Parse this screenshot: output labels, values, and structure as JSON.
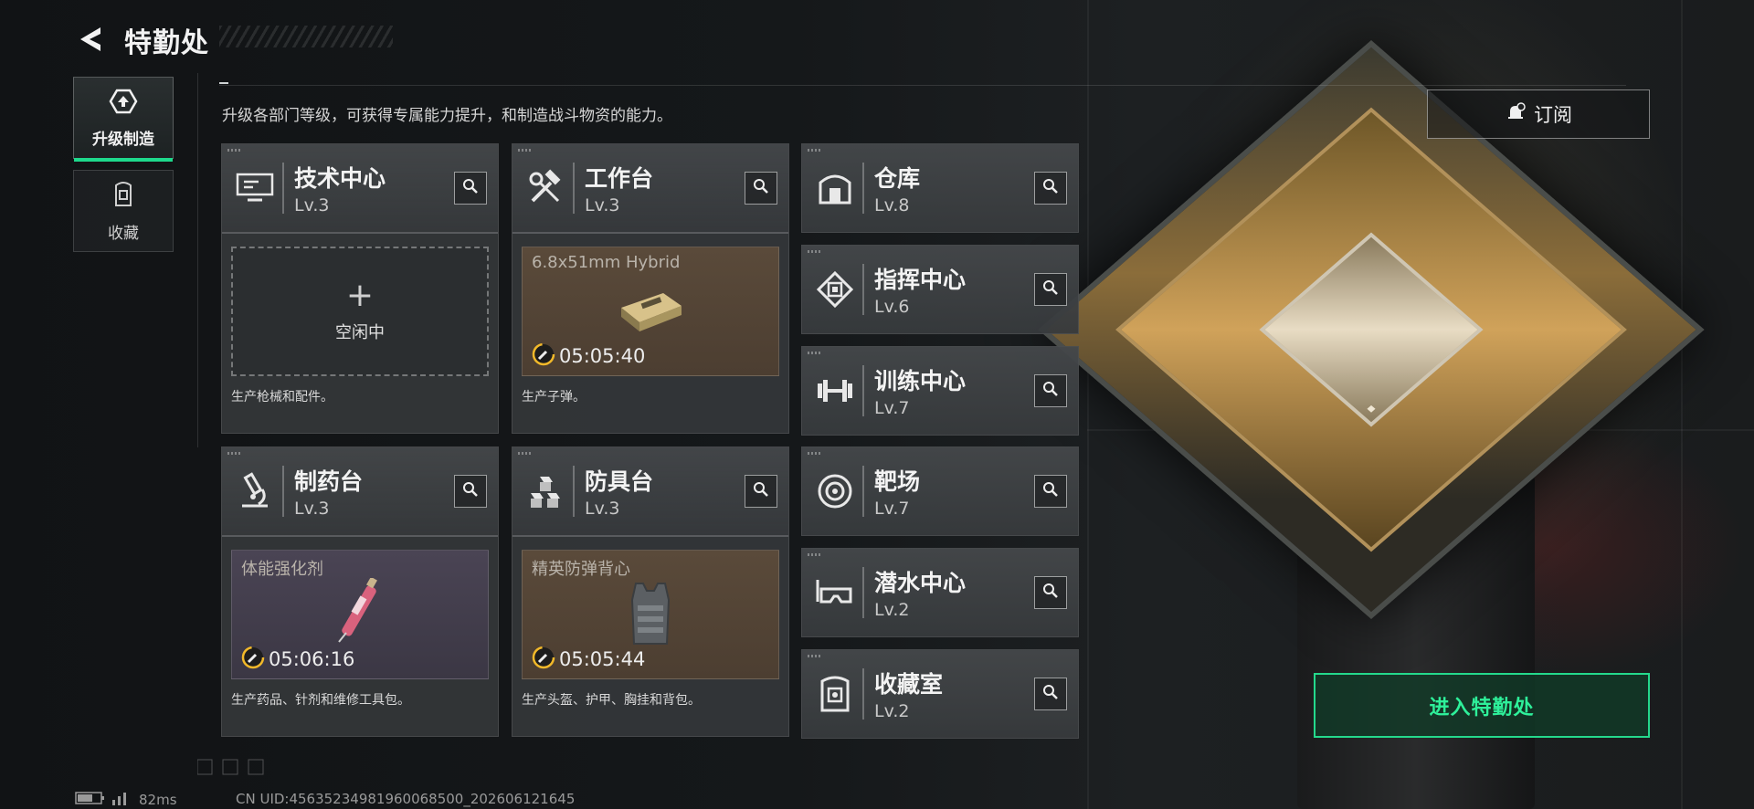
{
  "header": {
    "title": "特勤处"
  },
  "tabs": [
    {
      "label": "升级制造",
      "icon": "upgrade-icon",
      "active": true
    },
    {
      "label": "收藏",
      "icon": "collection-icon",
      "active": false
    }
  ],
  "subtitle": "升级各部门等级，可获得专属能力提升，和制造战斗物资的能力。",
  "stations_main": [
    {
      "name": "技术中心",
      "level": "Lv.3",
      "icon": "computer-icon",
      "slot": {
        "state": "idle",
        "plus": "+",
        "idle_label": "空闲中"
      },
      "description": "生产枪械和配件。"
    },
    {
      "name": "工作台",
      "level": "Lv.3",
      "icon": "tools-icon",
      "slot": {
        "state": "producing",
        "item": "6.8x51mm Hybrid",
        "timer": "05:05:40",
        "item_icon": "ammo-box-icon"
      },
      "description": "生产子弹。"
    },
    {
      "name": "制药台",
      "level": "Lv.3",
      "icon": "microscope-icon",
      "slot": {
        "state": "producing",
        "item": "体能强化剂",
        "timer": "05:06:16",
        "item_icon": "syringe-icon"
      },
      "description": "生产药品、针剂和维修工具包。"
    },
    {
      "name": "防具台",
      "level": "Lv.3",
      "icon": "armor-blocks-icon",
      "slot": {
        "state": "producing",
        "item": "精英防弹背心",
        "timer": "05:05:44",
        "item_icon": "vest-icon"
      },
      "description": "生产头盔、护甲、胸挂和背包。"
    }
  ],
  "stations_side": [
    {
      "name": "仓库",
      "level": "Lv.8",
      "icon": "warehouse-icon"
    },
    {
      "name": "指挥中心",
      "level": "Lv.6",
      "icon": "chip-icon"
    },
    {
      "name": "训练中心",
      "level": "Lv.7",
      "icon": "dumbbell-icon"
    },
    {
      "name": "靶场",
      "level": "Lv.7",
      "icon": "target-icon"
    },
    {
      "name": "潜水中心",
      "level": "Lv.2",
      "icon": "diving-mask-icon"
    },
    {
      "name": "收藏室",
      "level": "Lv.2",
      "icon": "vault-icon"
    }
  ],
  "subscribe": {
    "label": "订阅"
  },
  "enter_button": {
    "label": "进入特勤处"
  },
  "status": {
    "ping": "82ms",
    "uid": "CN UID:45635234981960068500_202606121645"
  },
  "colors": {
    "accent": "#24d98c",
    "brown_slot": "#5a4a3a",
    "purple_slot": "#4a4454"
  }
}
